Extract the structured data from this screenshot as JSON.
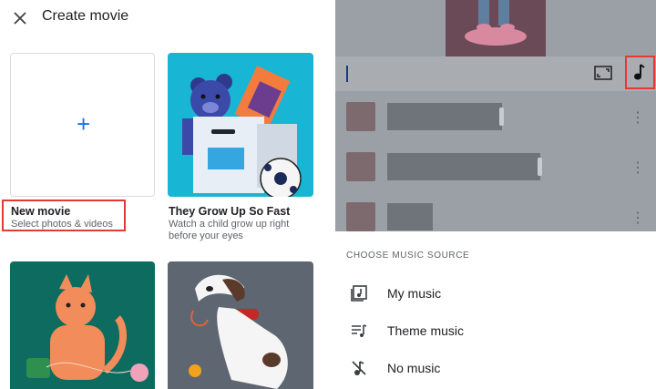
{
  "left_panel": {
    "title": "Create movie",
    "close_icon": "close-icon",
    "cards": [
      {
        "title": "New movie",
        "subtitle": "Select photos & videos",
        "icon": "plus-icon"
      },
      {
        "title": "They Grow Up So Fast",
        "subtitle_line1": "Watch a child grow up right",
        "subtitle_line2": "before your eyes"
      }
    ],
    "plus_symbol": "+"
  },
  "right_panel": {
    "toolbar": {
      "fit_icon": "fullscreen-icon",
      "music_icon": "music-note-icon"
    },
    "more_symbol": "⋮",
    "music_sheet": {
      "heading": "CHOOSE MUSIC SOURCE",
      "options": [
        {
          "label": "My music",
          "icon": "library-music-icon"
        },
        {
          "label": "Theme music",
          "icon": "queue-music-icon"
        },
        {
          "label": "No music",
          "icon": "music-off-icon"
        }
      ]
    }
  },
  "colors": {
    "accent": "#1a73e8",
    "highlight": "#e53935",
    "scrim": "#9aa0a6"
  }
}
